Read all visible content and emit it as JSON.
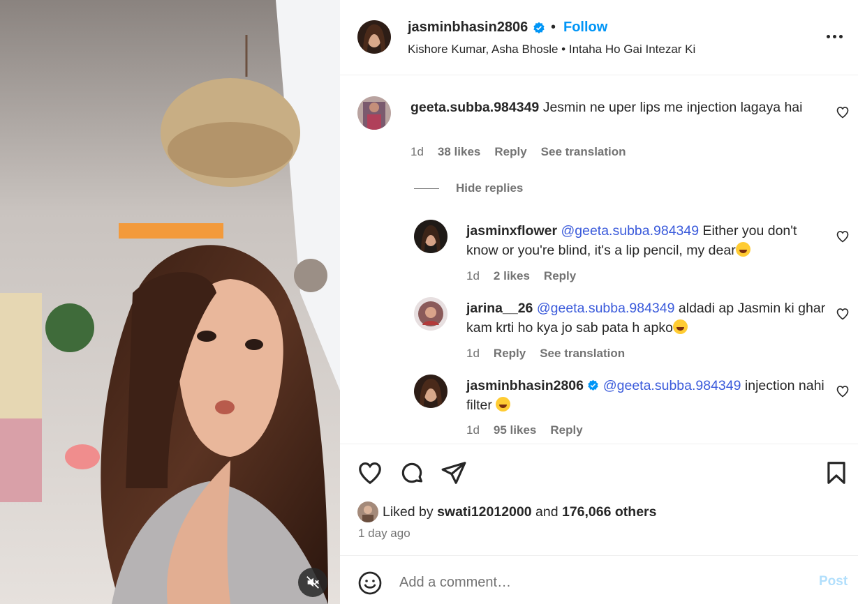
{
  "post": {
    "author": "jasminbhasin2806",
    "follow_label": "Follow",
    "separator": "•",
    "audio": "Kishore Kumar, Asha Bhosle • Intaha Ho Gai Intezar Ki"
  },
  "comments": [
    {
      "user": "geeta.subba.984349",
      "text": "Jesmin ne uper lips me injection lagaya hai",
      "time": "1d",
      "likes": "38 likes",
      "reply_label": "Reply",
      "translation_label": "See translation"
    }
  ],
  "hide_replies_label": "Hide replies",
  "replies": [
    {
      "user": "jasminxflower",
      "mention": "@geeta.subba.984349",
      "text_line1": "Either you don't",
      "text_line2": "know or you're blind, it's a lip pencil, my dear",
      "emoji": "kissing-face",
      "time": "1d",
      "likes": "2 likes",
      "reply_label": "Reply"
    },
    {
      "user": "jarina__26",
      "mention": "@geeta.subba.984349",
      "text_line1": "aldadi ap Jasmin ki",
      "text_line2": "ghar kam krti ho kya jo sab pata h apko",
      "emoji": "laughing-face",
      "time": "1d",
      "reply_label": "Reply",
      "translation_label": "See translation"
    },
    {
      "user": "jasminbhasin2806",
      "verified": true,
      "mention": "@geeta.subba.984349",
      "text_line1": "injection",
      "text_line2": "nahi filter",
      "emoji": "laughing-face",
      "time": "1d",
      "likes": "95 likes",
      "reply_label": "Reply"
    }
  ],
  "likes_summary": {
    "prefix": "Liked by",
    "user": "swati12012000",
    "and": "and",
    "others": "176,066 others"
  },
  "posted_ago": "1 day ago",
  "add_comment": {
    "placeholder": "Add a comment…",
    "post_label": "Post"
  },
  "colors": {
    "link_blue": "#0095f6",
    "mention_blue": "#3b5bdb",
    "muted_gray": "#737373",
    "post_disabled": "#b2dffc"
  },
  "icons": [
    "verified-icon",
    "more-icon",
    "heart-icon",
    "comment-icon",
    "share-icon",
    "save-icon",
    "smile-icon",
    "mute-icon"
  ]
}
